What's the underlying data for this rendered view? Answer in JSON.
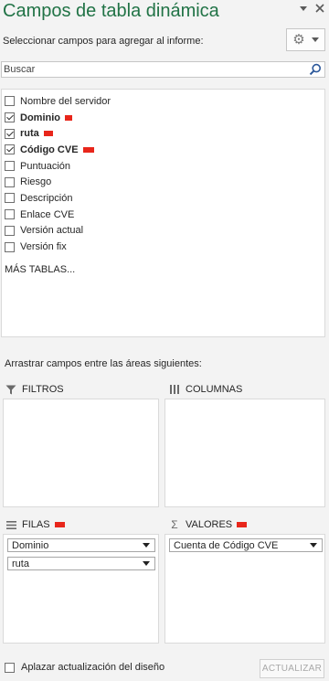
{
  "panel": {
    "title": "Campos de tabla dinámica",
    "choose_fields_label": "Seleccionar campos para agregar al informe:",
    "tools_icon": "gear-icon",
    "search": {
      "placeholder": "Buscar",
      "value": ""
    }
  },
  "fields": [
    {
      "label": "Nombre del servidor",
      "checked": false,
      "bold": false
    },
    {
      "label": "Dominio",
      "checked": true,
      "bold": true
    },
    {
      "label": "ruta",
      "checked": true,
      "bold": true
    },
    {
      "label": "Código CVE",
      "checked": true,
      "bold": true
    },
    {
      "label": "Puntuación",
      "checked": false,
      "bold": false
    },
    {
      "label": "Riesgo",
      "checked": false,
      "bold": false
    },
    {
      "label": "Descripción",
      "checked": false,
      "bold": false
    },
    {
      "label": "Enlace CVE",
      "checked": false,
      "bold": false
    },
    {
      "label": "Versión actual",
      "checked": false,
      "bold": false
    },
    {
      "label": "Versión fix",
      "checked": false,
      "bold": false
    }
  ],
  "more_tables": "MÁS TABLAS...",
  "drag_label": "Arrastrar campos entre las áreas siguientes:",
  "areas": {
    "filters": {
      "label": "FILTROS",
      "icon": "filter-icon"
    },
    "columns": {
      "label": "COLUMNAS",
      "icon": "columns-icon"
    },
    "rows": {
      "label": "FILAS",
      "icon": "rows-icon",
      "items": [
        "Dominio",
        "ruta"
      ]
    },
    "values": {
      "label": "VALORES",
      "icon": "sigma-icon",
      "symbol": "Σ",
      "items": [
        "Cuenta de Código CVE"
      ]
    }
  },
  "footer": {
    "defer_label": "Aplazar actualización del diseño",
    "defer_checked": false,
    "update_label": "ACTUALIZAR"
  },
  "colors": {
    "title": "#217346",
    "redaction": "#e8261b",
    "background": "#f3f3f3"
  }
}
